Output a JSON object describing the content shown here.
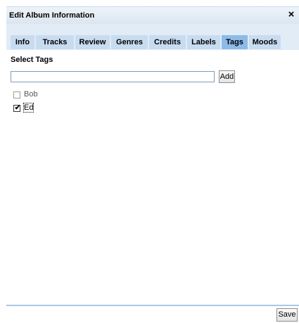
{
  "dialog": {
    "title": "Edit Album Information",
    "close_icon": "×"
  },
  "tabs": [
    {
      "label": "Info",
      "active": false
    },
    {
      "label": "Tracks",
      "active": false
    },
    {
      "label": "Review",
      "active": false
    },
    {
      "label": "Genres",
      "active": false
    },
    {
      "label": "Credits",
      "active": false
    },
    {
      "label": "Labels",
      "active": false
    },
    {
      "label": "Tags",
      "active": true
    },
    {
      "label": "Moods",
      "active": false
    }
  ],
  "tags_panel": {
    "section_title": "Select Tags",
    "input_value": "",
    "add_label": "Add",
    "items": [
      {
        "label": "Bob",
        "checked": false
      },
      {
        "label": "Ed",
        "checked": true
      }
    ]
  },
  "footer": {
    "save_label": "Save"
  },
  "colors": {
    "titlebar": "#dbe6f1",
    "tab": "#c8dcf0",
    "tab_active": "#8dbbe8",
    "divider": "#a8c8e6"
  }
}
